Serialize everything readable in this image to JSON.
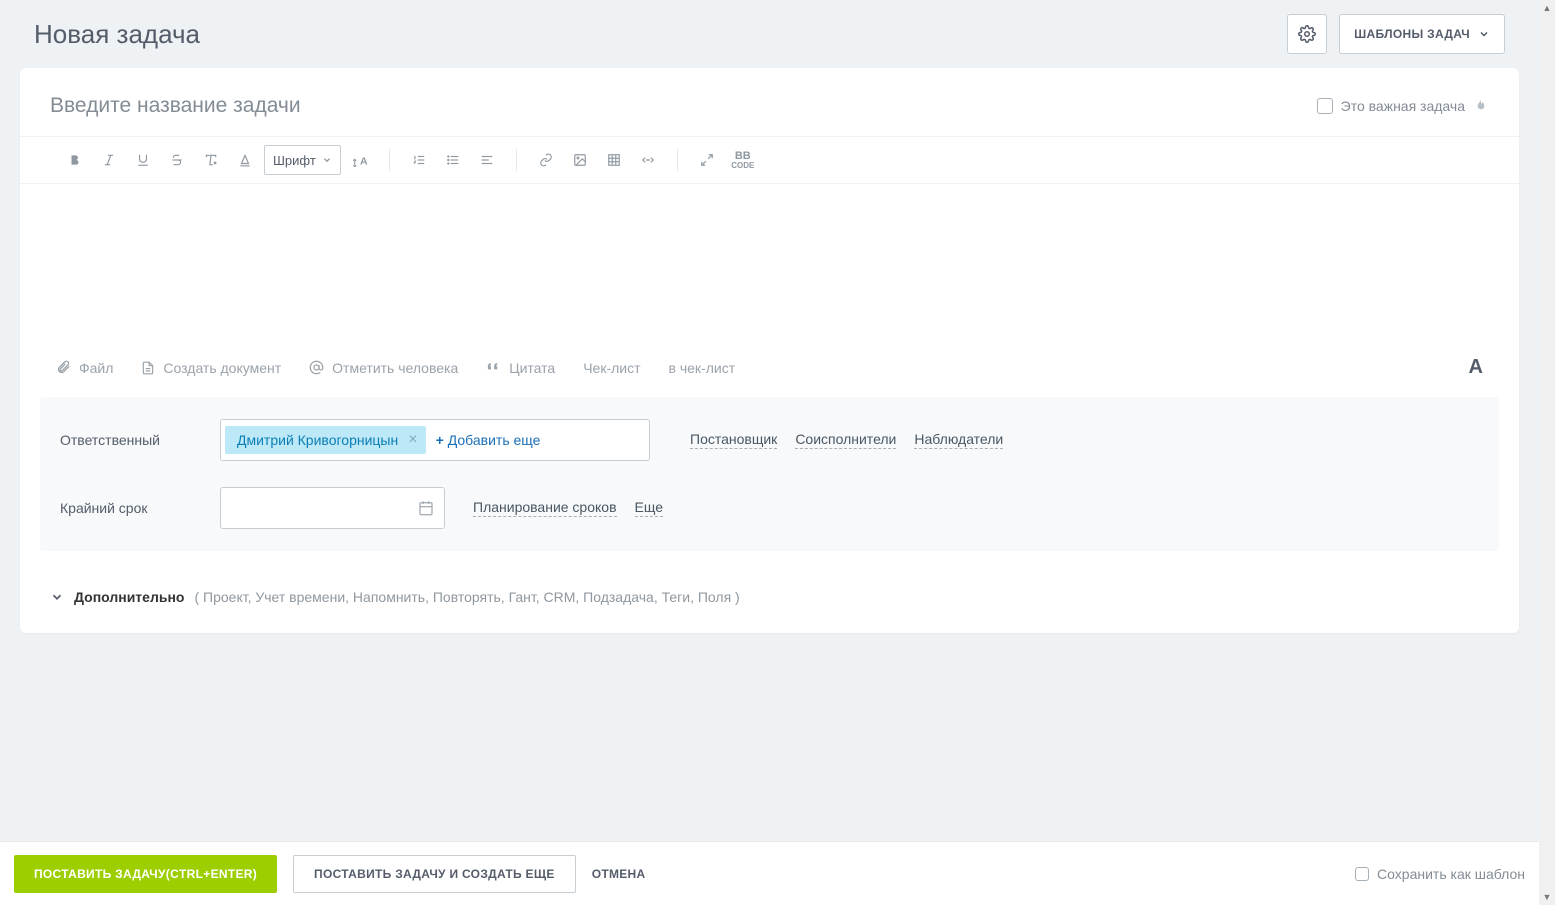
{
  "header": {
    "title": "Новая задача",
    "templates_label": "ШАБЛОНЫ ЗАДАЧ"
  },
  "title_block": {
    "placeholder": "Введите название задачи",
    "important_label": "Это важная задача"
  },
  "toolbar": {
    "font_label": "Шрифт",
    "bb_label": "BB",
    "bb_sub": "CODE"
  },
  "attachments": {
    "file": "Файл",
    "create_doc": "Создать документ",
    "mention": "Отметить человека",
    "quote": "Цитата",
    "checklist": "Чек-лист",
    "to_checklist": "в чек-лист"
  },
  "form": {
    "responsible_label": "Ответственный",
    "responsible_person": "Дмитрий Кривогорницын",
    "add_more": "Добавить еще",
    "roles": {
      "creator": "Постановщик",
      "accomplices": "Соисполнители",
      "observers": "Наблюдатели"
    },
    "deadline_label": "Крайний срок",
    "planning": "Планирование сроков",
    "more": "Еще"
  },
  "additional": {
    "label": "Дополнительно",
    "items": "( Проект,  Учет времени,  Напомнить,  Повторять,  Гант,  CRM,  Подзадача,  Теги,  Поля )"
  },
  "footer": {
    "submit": "ПОСТАВИТЬ ЗАДАЧУ(CTRL+ENTER)",
    "submit_again": "ПОСТАВИТЬ ЗАДАЧУ И СОЗДАТЬ ЕЩЕ",
    "cancel": "ОТМЕНА",
    "save_template": "Сохранить как шаблон"
  }
}
